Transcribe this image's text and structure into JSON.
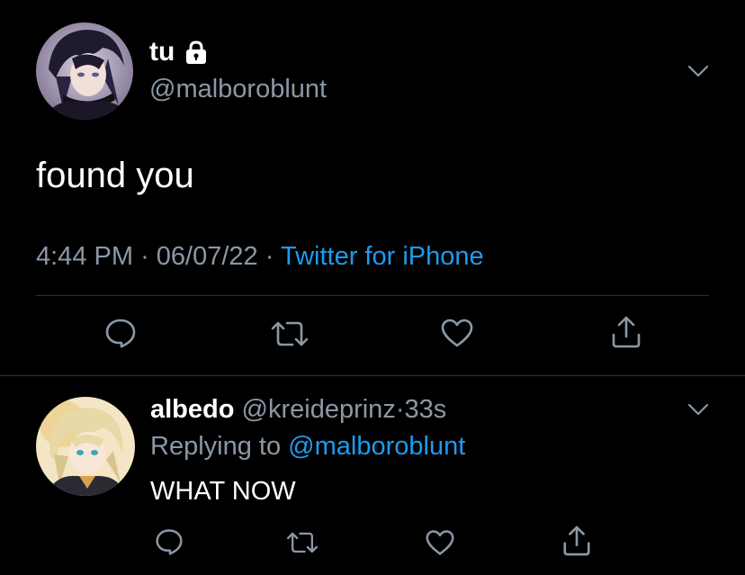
{
  "main_tweet": {
    "display_name": "tu",
    "handle": "@malboroblunt",
    "text": "found you",
    "time": "4:44 PM",
    "separator": "·",
    "date": "06/07/22",
    "source": "Twitter for iPhone",
    "icons": {
      "lock": "lock-icon",
      "menu": "chevron-down-icon",
      "reply": "comment-icon",
      "retweet": "retweet-icon",
      "like": "heart-icon",
      "share": "share-icon"
    }
  },
  "reply_tweet": {
    "display_name": "albedo",
    "handle": "@kreideprinz",
    "separator": "·",
    "time_ago": "33s",
    "replying_label": "Replying to",
    "replying_to": "@malboroblunt",
    "text": "WHAT NOW"
  },
  "colors": {
    "background": "#000000",
    "text_primary": "#ffffff",
    "text_secondary": "#8b98a5",
    "accent": "#1d9bf0",
    "divider": "#2f3336"
  }
}
